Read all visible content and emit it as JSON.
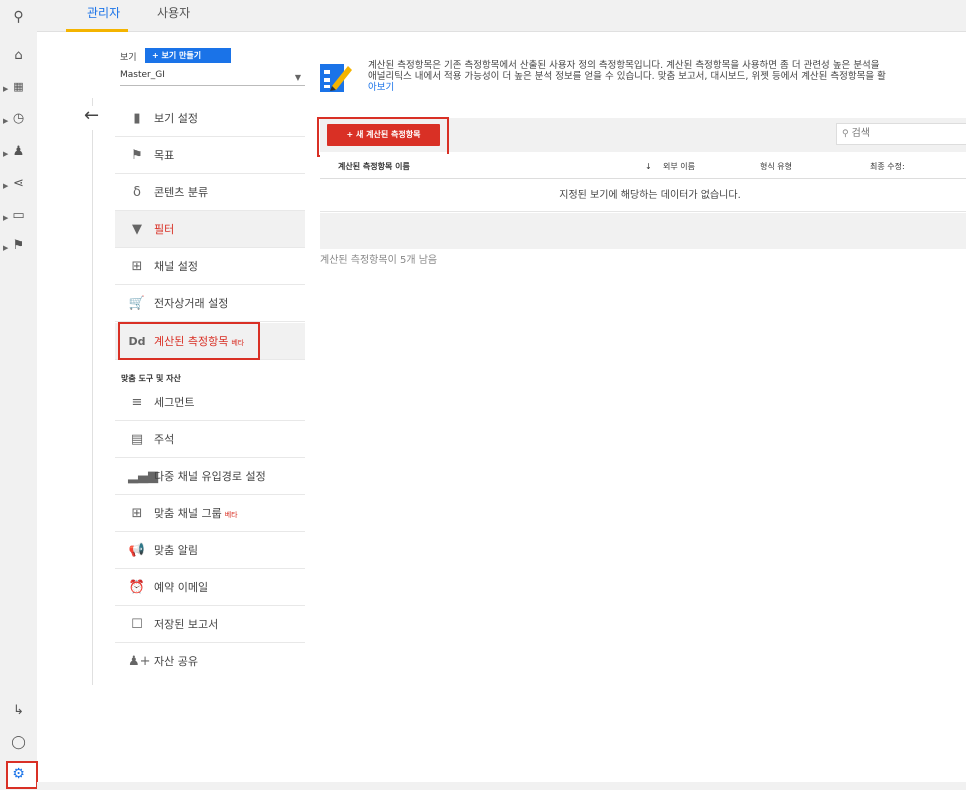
{
  "tabs": {
    "admin": "관리자",
    "user": "사용자"
  },
  "view": {
    "label": "보기",
    "create_button": "+ 보기 만들기",
    "selected": "Master_GI"
  },
  "menu": [
    {
      "label": "보기 설정",
      "icon": "document-icon"
    },
    {
      "label": "목표",
      "icon": "flag-icon"
    },
    {
      "label": "콘텐츠 분류",
      "icon": "person-walk-icon"
    },
    {
      "label": "필터",
      "icon": "filter-icon"
    },
    {
      "label": "채널 설정",
      "icon": "channel-icon"
    },
    {
      "label": "전자상거래 설정",
      "icon": "cart-icon"
    },
    {
      "label": "계산된 측정항목",
      "icon": "dd-icon",
      "badge": "베타"
    }
  ],
  "section_header": "맞춤 도구 및 자산",
  "assets": [
    {
      "label": "세그먼트",
      "icon": "segment-icon"
    },
    {
      "label": "주석",
      "icon": "comment-icon"
    },
    {
      "label": "다중 채널 유입경로 설정",
      "icon": "bar-chart-icon"
    },
    {
      "label": "맞춤 채널 그룹",
      "icon": "channel-group-icon",
      "badge": "베타"
    },
    {
      "label": "맞춤 알림",
      "icon": "megaphone-icon"
    },
    {
      "label": "예약 이메일",
      "icon": "clock-icon"
    },
    {
      "label": "저장된 보고서",
      "icon": "saved-report-icon"
    },
    {
      "label": "자산 공유",
      "icon": "share-person-icon"
    }
  ],
  "info": {
    "line1": "계산된 측정항목은 기존 측정항목에서 산출된 사용자 정의 측정항목입니다. 계산된 측정항목을 사용하면 좀 더 관련성 높은 분석을",
    "line2": "애널리틱스 내에서 적용 가능성이 더 높은 분석 정보를 얻을 수 있습니다. 맞춤 보고서, 대시보드, 위젯 등에서 계산된 측정항목을 활",
    "link": "아보기"
  },
  "new_button": "+ 새 계산된 측정항목",
  "search_placeholder": "검색",
  "table": {
    "headers": [
      "계산된 측정항목 이름",
      "외부 이름",
      "형식 유형",
      "최종 수정:"
    ],
    "empty_message": "지정된 보기에 해당하는 데이터가 없습니다."
  },
  "remaining": "계산된 측정항목이 5개 남음",
  "colors": {
    "accent_blue": "#1a73e8",
    "accent_red": "#d93025",
    "tab_underline": "#f4b400"
  }
}
